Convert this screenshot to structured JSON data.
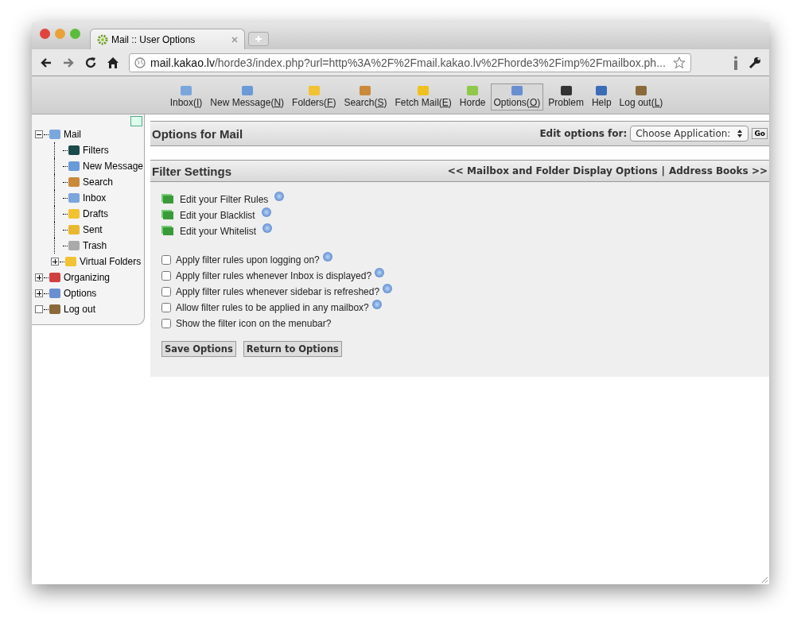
{
  "browser": {
    "tab_title": "Mail :: User Options",
    "url_host": "mail.kakao.lv",
    "url_path": "/horde3/index.php?url=http%3A%2F%2Fmail.kakao.lv%2Fhorde3%2Fimp%2Fmailbox.ph..."
  },
  "toolbar": [
    {
      "kind": "inbox",
      "label": "Inbox(I)",
      "accesskey": true,
      "selected": false
    },
    {
      "kind": "compose",
      "label": "New Message(N)",
      "accesskey": true,
      "selected": false
    },
    {
      "kind": "folders",
      "label": "Folders(F)",
      "accesskey": true,
      "selected": false
    },
    {
      "kind": "search",
      "label": "Search(S)",
      "accesskey": true,
      "selected": false
    },
    {
      "kind": "fetch",
      "label": "Fetch Mail(E)",
      "accesskey": true,
      "selected": false
    },
    {
      "kind": "horde",
      "label": "Horde",
      "accesskey": false,
      "selected": false
    },
    {
      "kind": "options",
      "label": "Options(O)",
      "accesskey": true,
      "selected": true
    },
    {
      "kind": "problem",
      "label": "Problem",
      "accesskey": false,
      "selected": false
    },
    {
      "kind": "help",
      "label": "Help",
      "accesskey": false,
      "selected": false
    },
    {
      "kind": "logout",
      "label": "Log out(L)",
      "accesskey": true,
      "selected": false
    }
  ],
  "sidebar": {
    "tree": [
      {
        "label": "Mail",
        "kind": "inbox",
        "expanded": true,
        "children": [
          {
            "label": "Filters",
            "kind": "filter"
          },
          {
            "label": "New Message",
            "kind": "compose"
          },
          {
            "label": "Search",
            "kind": "search"
          },
          {
            "label": "Inbox",
            "kind": "inbox"
          },
          {
            "label": "Drafts",
            "kind": "folders"
          },
          {
            "label": "Sent",
            "kind": "sent"
          },
          {
            "label": "Trash",
            "kind": "trash"
          },
          {
            "label": "Virtual Folders",
            "kind": "folders",
            "expanded": false
          }
        ]
      },
      {
        "label": "Organizing",
        "kind": "organizing",
        "expanded": false
      },
      {
        "label": "Options",
        "kind": "options",
        "expanded": false
      },
      {
        "label": "Log out",
        "kind": "logout"
      }
    ]
  },
  "options_header": {
    "title": "Options for Mail",
    "edit_label": "Edit options for:",
    "select_value": "Choose Application:",
    "go_button": "Go"
  },
  "filter_settings": {
    "title": "Filter Settings",
    "prev_link": "<< Mailbox and Folder Display Options",
    "separator": "|",
    "next_link": "Address Books >>",
    "links": [
      "Edit your Filter Rules",
      "Edit your Blacklist",
      "Edit your Whitelist"
    ],
    "checkboxes": [
      {
        "label": "Apply filter rules upon logging on?",
        "checked": false,
        "help": true
      },
      {
        "label": "Apply filter rules whenever Inbox is displayed?",
        "checked": false,
        "help": true
      },
      {
        "label": "Apply filter rules whenever sidebar is refreshed?",
        "checked": false,
        "help": true
      },
      {
        "label": "Allow filter rules to be applied in any mailbox?",
        "checked": false,
        "help": true
      },
      {
        "label": "Show the filter icon on the menubar?",
        "checked": false,
        "help": false
      }
    ],
    "buttons": [
      "Save Options",
      "Return to Options"
    ]
  }
}
